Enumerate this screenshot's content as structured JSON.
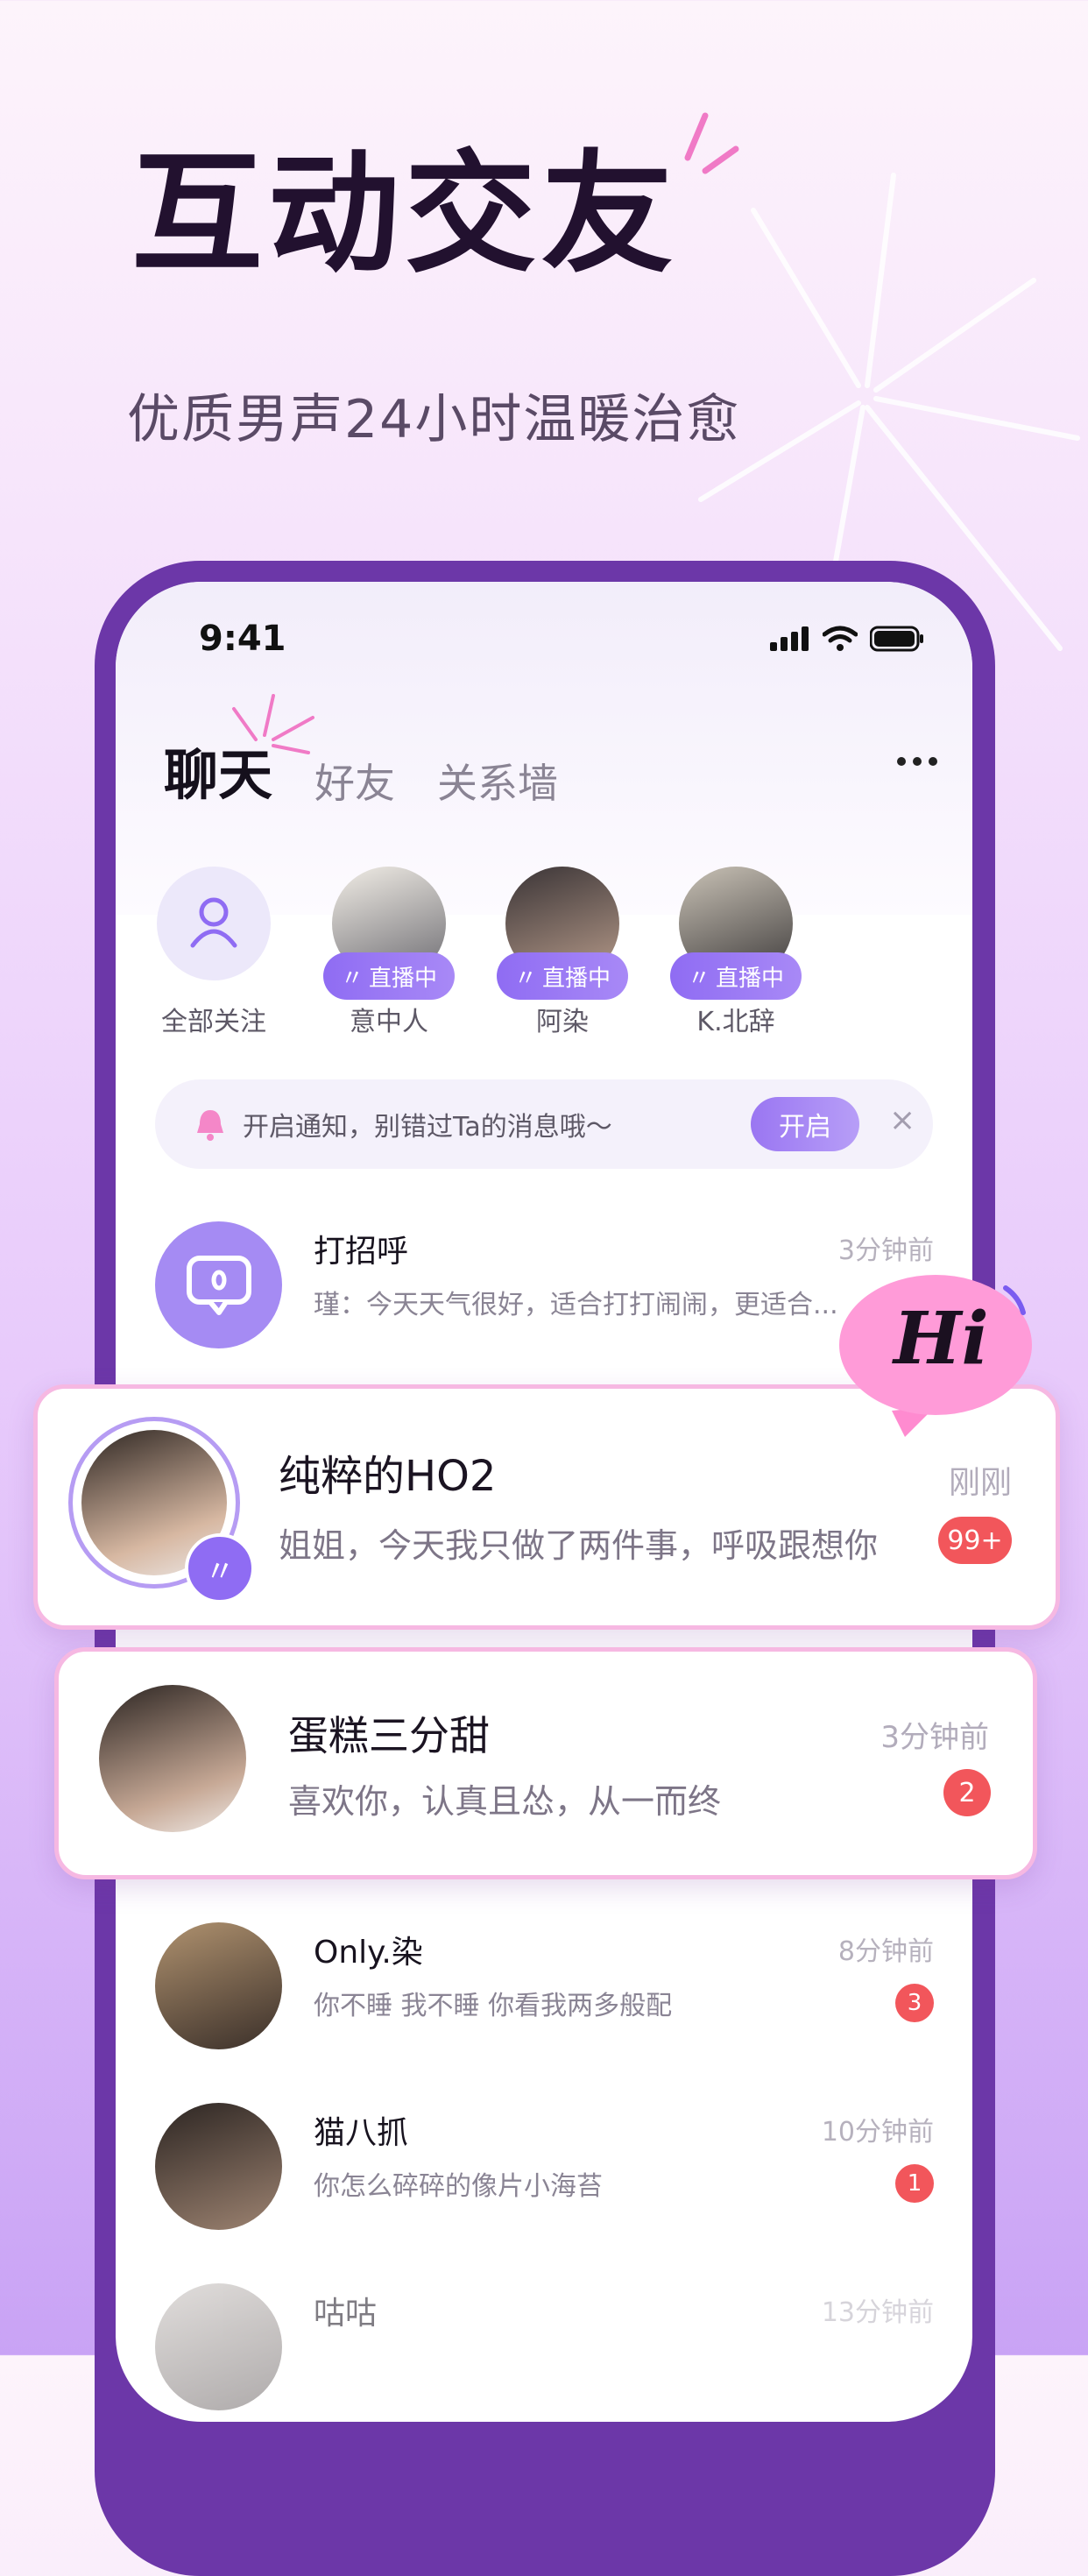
{
  "hero": {
    "title": "互动交友",
    "subtitle": "优质男声24小时温暖治愈"
  },
  "status": {
    "time": "9:41"
  },
  "tabs": [
    {
      "label": "聊天"
    },
    {
      "label": "好友"
    },
    {
      "label": "关系墙"
    }
  ],
  "stories": [
    {
      "name": "全部关注",
      "icon": "user-icon"
    },
    {
      "name": "意中人",
      "badge": "直播中"
    },
    {
      "name": "阿染",
      "badge": "直播中"
    },
    {
      "name": "K.北辞",
      "badge": "直播中"
    }
  ],
  "notice": {
    "text": "开启通知，别错过Ta的消息哦～",
    "button": "开启",
    "close": "×"
  },
  "greeting": {
    "title": "打招呼",
    "message": "瑾：今天天气很好，适合打打闹闹，更适合...",
    "time": "3分钟前"
  },
  "featured": [
    {
      "name": "纯粹的HO2",
      "message": "姐姐，今天我只做了两件事，呼吸跟想你",
      "time": "刚刚",
      "badge": "99+"
    },
    {
      "name": "蛋糕三分甜",
      "message": "喜欢你，认真且怂，从一而终",
      "time": "3分钟前",
      "badge": "2"
    }
  ],
  "chats": [
    {
      "name": "Only.染",
      "message": "你不睡 我不睡 你看我两多般配",
      "time": "8分钟前",
      "badge": "3"
    },
    {
      "name": "猫八抓",
      "message": "你怎么碎碎的像片小海苔",
      "time": "10分钟前",
      "badge": "1"
    },
    {
      "name": "咕咕",
      "message": "",
      "time": "13分钟前",
      "badge": ""
    }
  ],
  "hi_bubble": "Hi",
  "colors": {
    "accent": "#9a76f2",
    "phone_frame": "#6c37a8",
    "badge_red": "#f2565b",
    "card_border": "#f6b8e2"
  }
}
